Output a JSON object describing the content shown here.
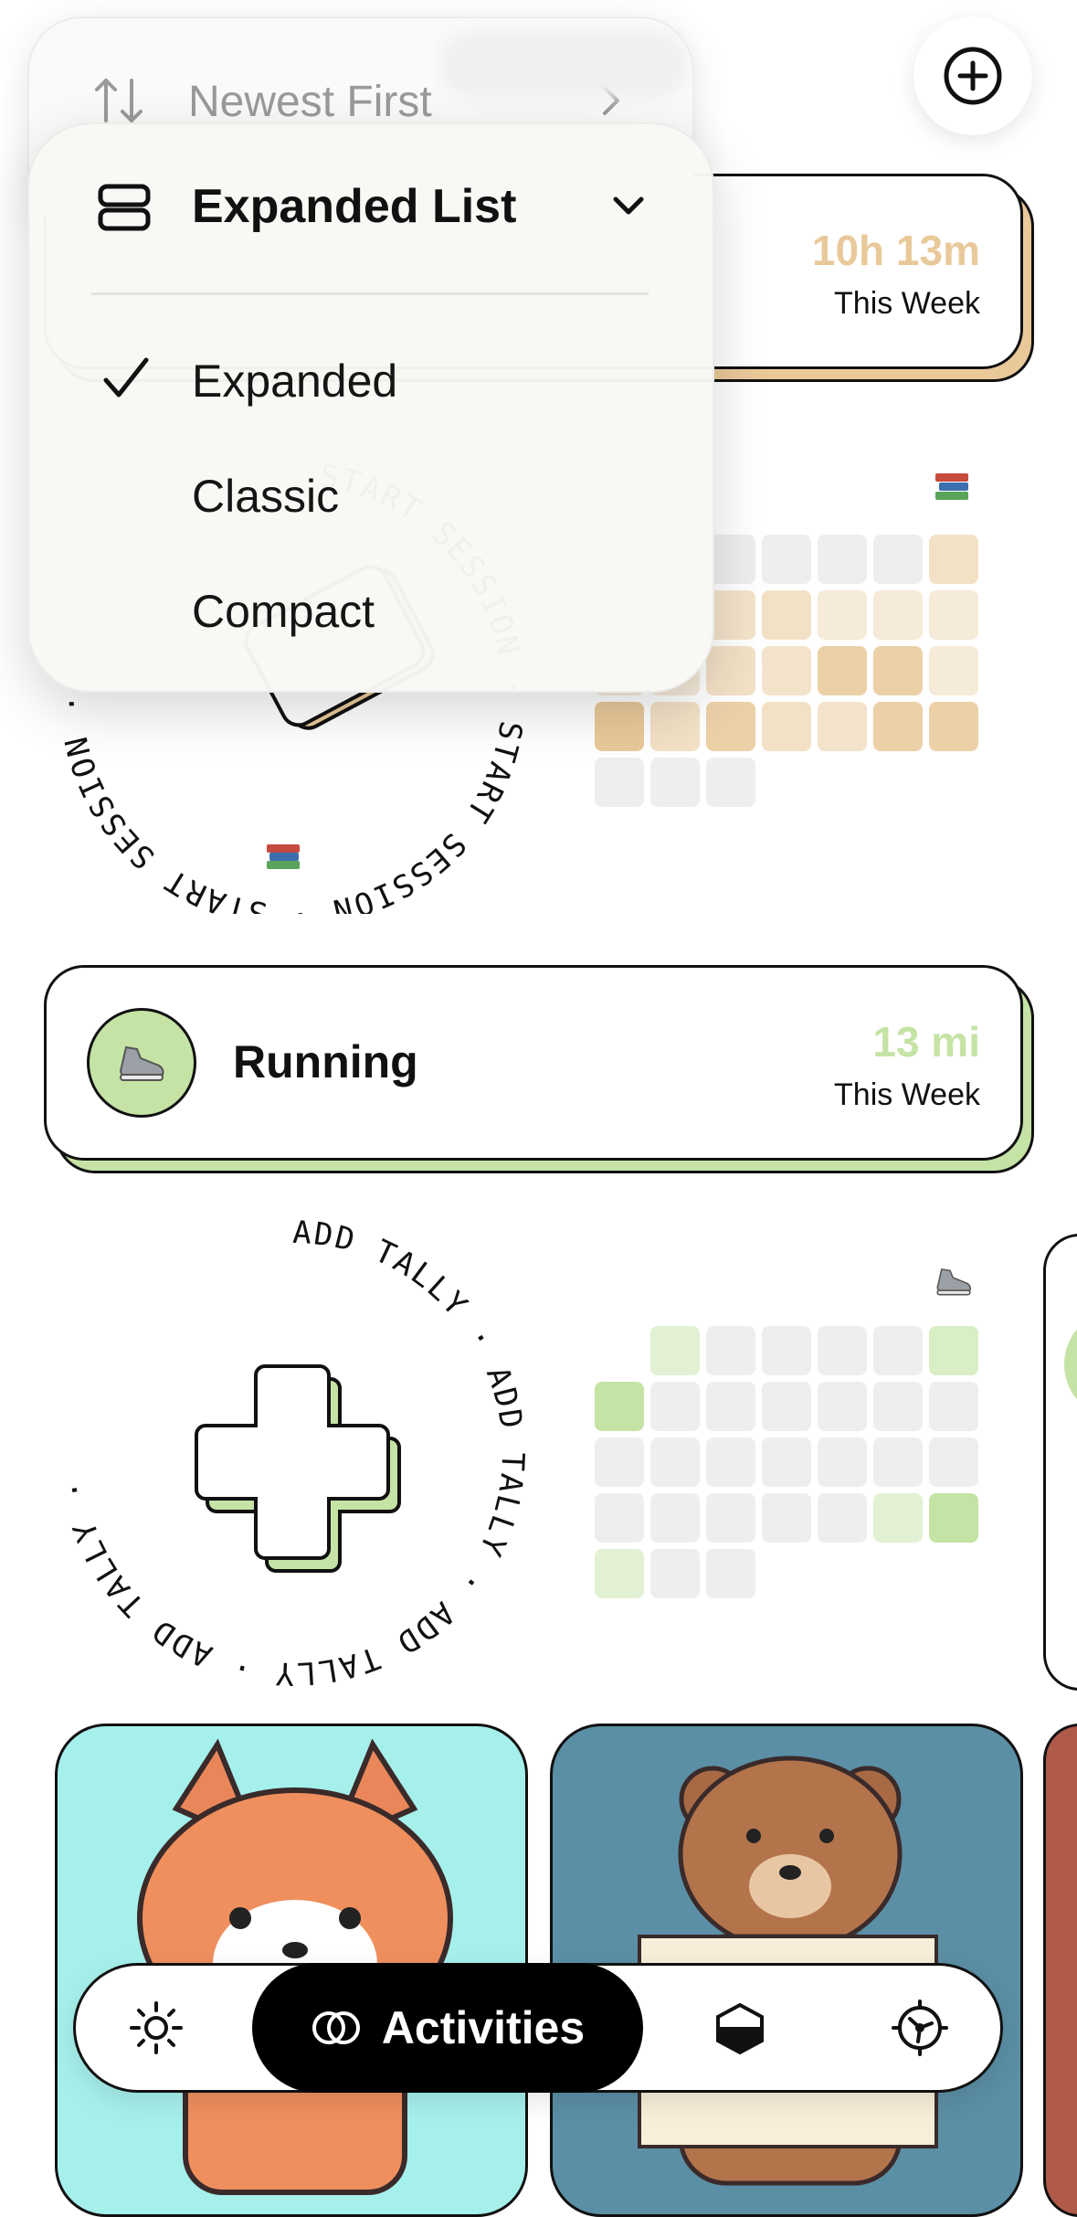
{
  "sort_menu": {
    "label": "Newest First"
  },
  "view_menu": {
    "header": "Expanded List",
    "options": [
      "Expanded",
      "Classic",
      "Compact"
    ],
    "selected": "Expanded"
  },
  "reading": {
    "stat_value": "10h 13m",
    "stat_label": "This Week",
    "ring_text": "START SESSION",
    "accent": "#e9c99a"
  },
  "running": {
    "title": "Running",
    "stat_value": "13 mi",
    "stat_label": "This Week",
    "ring_text": "ADD TALLY",
    "accent": "#c5e3a5"
  },
  "tabbar": {
    "active_label": "Activities",
    "icons": [
      "sun-icon",
      "toggle-icon",
      "hexagon-icon",
      "gear-icon"
    ]
  },
  "icons": {
    "add": "plus-circle-icon",
    "sort": "sort-arrows-icon",
    "layout": "layout-rows-icon",
    "book": "books-icon",
    "shoe": "shoe-icon"
  }
}
